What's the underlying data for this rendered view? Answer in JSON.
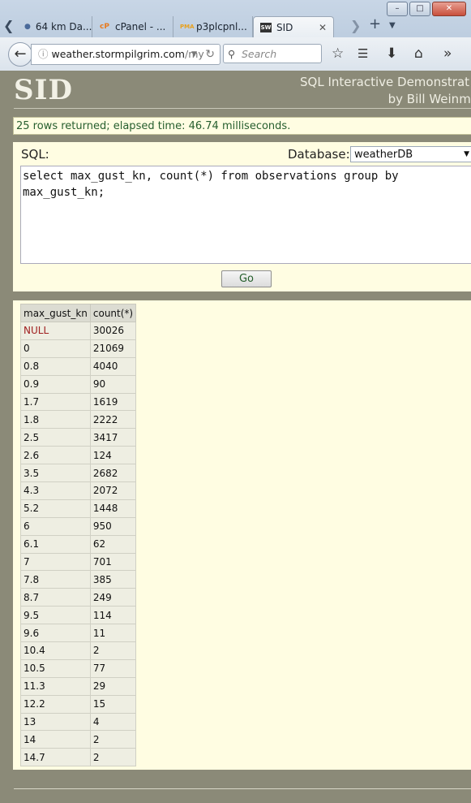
{
  "browser": {
    "tabs": [
      {
        "label": "64 km Da...",
        "favicon": "globe-icon"
      },
      {
        "label": "cPanel - ...",
        "favicon": "cpanel-icon"
      },
      {
        "label": "p3plcpnl...",
        "favicon": "phpmyadmin-icon"
      },
      {
        "label": "SID",
        "favicon": "sid-icon",
        "active": true
      }
    ],
    "url_host": "weather.stormpilgrim.com",
    "url_path": "/my",
    "search_placeholder": "Search",
    "cpanel_glyph": "cP",
    "pma_glyph": "PMA",
    "sid_glyph": "SW"
  },
  "header": {
    "logo": "SID",
    "tagline_1": "SQL Interactive Demonstrat",
    "tagline_2": "by Bill Weinma"
  },
  "message": "25 rows returned; elapsed time: 46.74 milliseconds.",
  "form": {
    "sql_label": "SQL:",
    "database_label": "Database:",
    "database_value": "weatherDB",
    "query": "select max_gust_kn, count(*) from observations group by\nmax_gust_kn;",
    "go_label": "Go"
  },
  "results": {
    "columns": [
      "max_gust_kn",
      "count(*)"
    ],
    "rows": [
      [
        "NULL",
        "30026"
      ],
      [
        "0",
        "21069"
      ],
      [
        "0.8",
        "4040"
      ],
      [
        "0.9",
        "90"
      ],
      [
        "1.7",
        "1619"
      ],
      [
        "1.8",
        "2222"
      ],
      [
        "2.5",
        "3417"
      ],
      [
        "2.6",
        "124"
      ],
      [
        "3.5",
        "2682"
      ],
      [
        "4.3",
        "2072"
      ],
      [
        "5.2",
        "1448"
      ],
      [
        "6",
        "950"
      ],
      [
        "6.1",
        "62"
      ],
      [
        "7",
        "701"
      ],
      [
        "7.8",
        "385"
      ],
      [
        "8.7",
        "249"
      ],
      [
        "9.5",
        "114"
      ],
      [
        "9.6",
        "11"
      ],
      [
        "10.4",
        "2"
      ],
      [
        "10.5",
        "77"
      ],
      [
        "11.3",
        "29"
      ],
      [
        "12.2",
        "15"
      ],
      [
        "13",
        "4"
      ],
      [
        "14",
        "2"
      ],
      [
        "14.7",
        "2"
      ]
    ]
  }
}
